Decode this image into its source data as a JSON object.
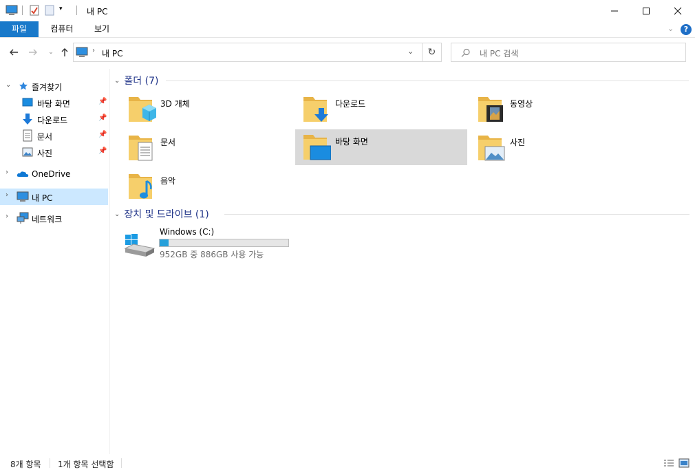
{
  "window": {
    "title": "내 PC"
  },
  "ribbon": {
    "tabs": [
      {
        "label": "파일"
      },
      {
        "label": "컴퓨터"
      },
      {
        "label": "보기"
      }
    ]
  },
  "nav": {
    "address": "내 PC",
    "search_placeholder": "내 PC 검색"
  },
  "sidebar": {
    "quick_access": "즐겨찾기",
    "quick_items": [
      {
        "label": "바탕 화면"
      },
      {
        "label": "다운로드"
      },
      {
        "label": "문서"
      },
      {
        "label": "사진"
      }
    ],
    "onedrive": "OneDrive",
    "this_pc": "내 PC",
    "network": "네트워크"
  },
  "folders": {
    "header": "폴더 (7)",
    "items": [
      {
        "label": "3D 개체"
      },
      {
        "label": "다운로드"
      },
      {
        "label": "동영상"
      },
      {
        "label": "문서"
      },
      {
        "label": "바탕 화면"
      },
      {
        "label": "사진"
      },
      {
        "label": "음악"
      }
    ]
  },
  "devices": {
    "header": "장치 및 드라이브 (1)",
    "drive": {
      "name": "Windows (C:)",
      "space": "952GB 중 886GB 사용 가능",
      "used_fraction": 0.07
    }
  },
  "status": {
    "items_count": "8개 항목",
    "selected": "1개 항목 선택함"
  },
  "colors": {
    "accent": "#1979ca",
    "group_title": "#1e3287",
    "folder": "#f6cf6b",
    "drive_bar": "#26a0da",
    "selection": "#cce8ff"
  }
}
